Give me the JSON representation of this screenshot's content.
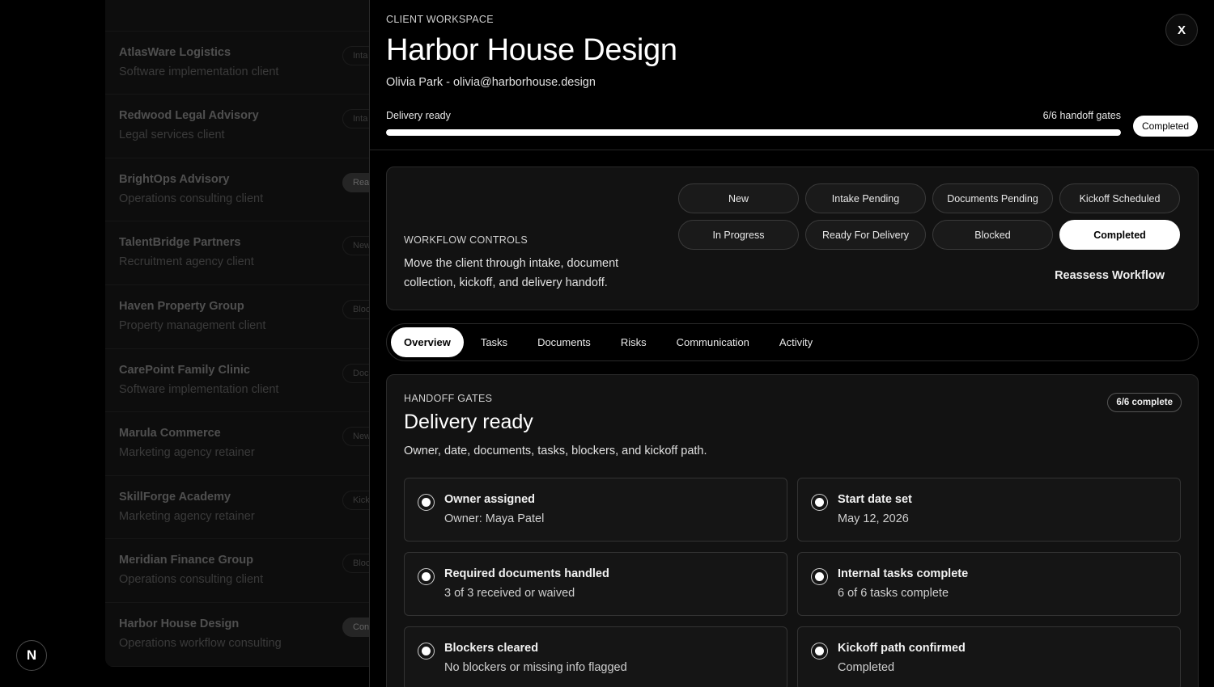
{
  "clients": [
    {
      "name": "",
      "sub": "Operations consulting client",
      "badge": ""
    },
    {
      "name": "AtlasWare Logistics",
      "sub": "Software implementation client",
      "badge": "Inta",
      "badge_filled": false
    },
    {
      "name": "Redwood Legal Advisory",
      "sub": "Legal services client",
      "badge": "Inta",
      "badge_filled": false
    },
    {
      "name": "BrightOps Advisory",
      "sub": "Operations consulting client",
      "badge": "Rea",
      "badge_filled": true
    },
    {
      "name": "TalentBridge Partners",
      "sub": "Recruitment agency client",
      "badge": "New",
      "badge_filled": false
    },
    {
      "name": "Haven Property Group",
      "sub": "Property management client",
      "badge": "Bloc",
      "badge_filled": false
    },
    {
      "name": "CarePoint Family Clinic",
      "sub": "Software implementation client",
      "badge": "Doc",
      "badge_filled": false
    },
    {
      "name": "Marula Commerce",
      "sub": "Marketing agency retainer",
      "badge": "New",
      "badge_filled": false
    },
    {
      "name": "SkillForge Academy",
      "sub": "Marketing agency retainer",
      "badge": "Kick",
      "badge_filled": false
    },
    {
      "name": "Meridian Finance Group",
      "sub": "Operations consulting client",
      "badge": "Bloc",
      "badge_filled": false
    },
    {
      "name": "Harbor House Design",
      "sub": "Operations workflow consulting",
      "badge": "Con",
      "badge_filled": true
    }
  ],
  "logo": "N",
  "header": {
    "eyebrow": "CLIENT WORKSPACE",
    "title": "Harbor House Design",
    "subtitle": "Olivia Park - olivia@harborhouse.design",
    "close_label": "X",
    "progress_label": "Delivery ready",
    "progress_count": "6/6 handoff gates",
    "progress_fraction": 1.0,
    "status": "Completed"
  },
  "controls": {
    "eyebrow": "WORKFLOW CONTROLS",
    "description": "Move the client through intake, document collection, kickoff, and delivery handoff.",
    "stages": [
      "New",
      "Intake Pending",
      "Documents Pending",
      "Kickoff Scheduled",
      "In Progress",
      "Ready For Delivery",
      "Blocked",
      "Completed"
    ],
    "active_stage": "Completed",
    "reassess_label": "Reassess Workflow"
  },
  "tabs": [
    "Overview",
    "Tasks",
    "Documents",
    "Risks",
    "Communication",
    "Activity"
  ],
  "active_tab": "Overview",
  "gates": {
    "eyebrow": "HANDOFF GATES",
    "title": "Delivery ready",
    "description": "Owner, date, documents, tasks, blockers, and kickoff path.",
    "count": "6/6 complete",
    "items": [
      {
        "title": "Owner assigned",
        "sub": "Owner: Maya Patel"
      },
      {
        "title": "Start date set",
        "sub": "May 12, 2026"
      },
      {
        "title": "Required documents handled",
        "sub": "3 of 3 received or waived"
      },
      {
        "title": "Internal tasks complete",
        "sub": "6 of 6 tasks complete"
      },
      {
        "title": "Blockers cleared",
        "sub": "No blockers or missing info flagged"
      },
      {
        "title": "Kickoff path confirmed",
        "sub": "Completed"
      }
    ]
  }
}
